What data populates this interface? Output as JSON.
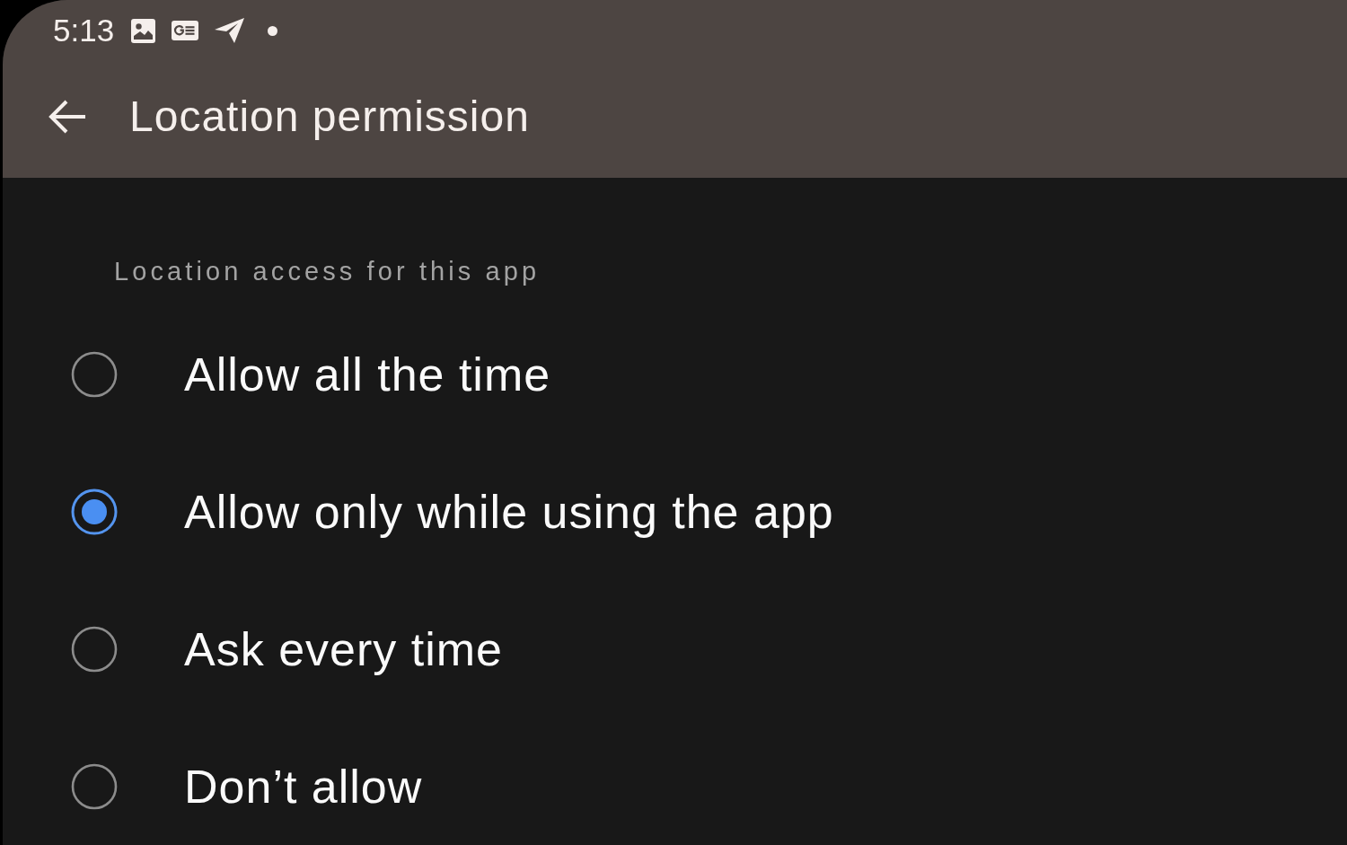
{
  "status_bar": {
    "time": "5:13"
  },
  "app_bar": {
    "title": "Location permission"
  },
  "section": {
    "title": "Location access for this app",
    "options": [
      {
        "label": "Allow all the time",
        "selected": false
      },
      {
        "label": "Allow only while using the app",
        "selected": true
      },
      {
        "label": "Ask every time",
        "selected": false
      },
      {
        "label": "Don’t allow",
        "selected": false
      }
    ]
  }
}
